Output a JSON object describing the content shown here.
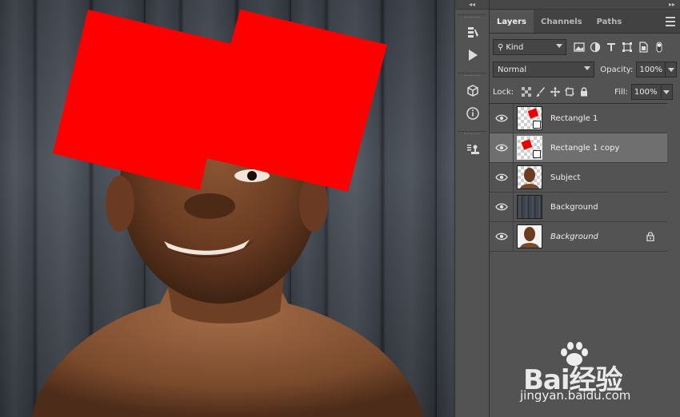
{
  "panel": {
    "tabs": [
      {
        "label": "Layers",
        "active": true
      },
      {
        "label": "Channels",
        "active": false
      },
      {
        "label": "Paths",
        "active": false
      }
    ],
    "filter": {
      "kind": "Kind"
    },
    "blend_mode": "Normal",
    "opacity_label": "Opacity:",
    "opacity_value": "100%",
    "lock_label": "Lock:",
    "fill_label": "Fill:",
    "fill_value": "100%",
    "layers": [
      {
        "name": "Rectangle 1",
        "type": "shape",
        "visible": true,
        "selected": false
      },
      {
        "name": "Rectangle 1 copy",
        "type": "shape",
        "visible": true,
        "selected": true
      },
      {
        "name": "Subject",
        "type": "image",
        "visible": true,
        "selected": false
      },
      {
        "name": "Background",
        "type": "image",
        "visible": true,
        "selected": false
      },
      {
        "name": "Background",
        "type": "image",
        "visible": true,
        "selected": false,
        "italic": true,
        "locked": true
      }
    ]
  },
  "toolstrip": {
    "icons": [
      "history-brush-icon",
      "play-action-icon",
      "3d-cube-icon",
      "info-icon",
      "stamp-icon"
    ]
  },
  "canvas": {
    "shape_color": "#ff0000"
  },
  "watermark": {
    "brand": "Bai经验",
    "url": "jingyan.baidu.com"
  }
}
